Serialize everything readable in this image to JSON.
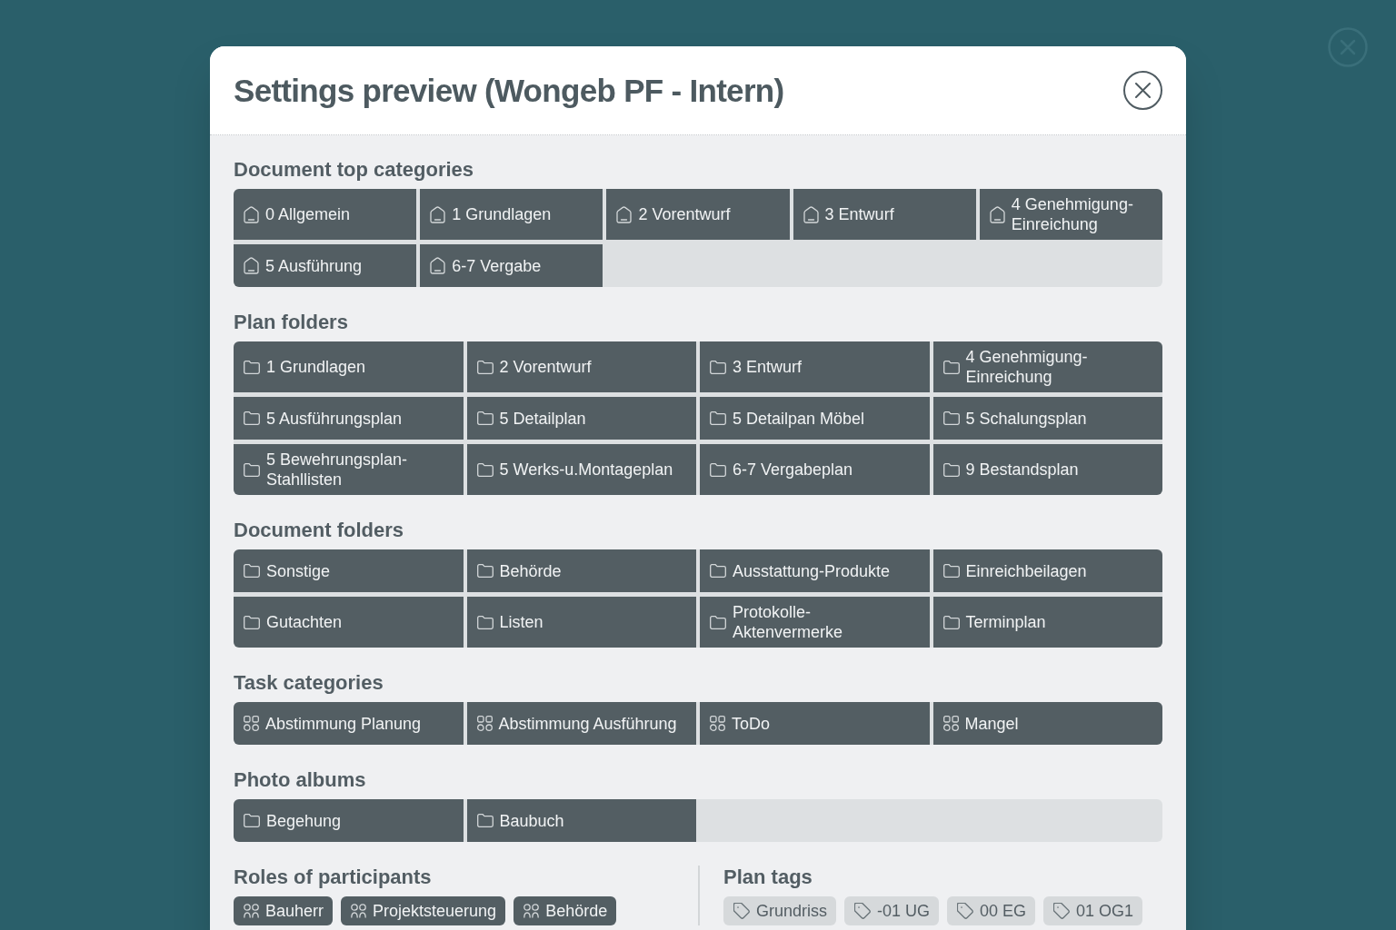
{
  "dialog": {
    "title": "Settings preview (Wongeb PF - Intern)"
  },
  "sections": [
    {
      "heading": "Document top categories",
      "kind": "category",
      "items": [
        "0 Allgemein",
        "1 Grundlagen",
        "2 Vorentwurf",
        "3 Entwurf",
        "4 Genehmigung-Einreichung",
        "5 Ausführung",
        "6-7 Vergabe"
      ]
    },
    {
      "heading": "Plan folders",
      "kind": "folder",
      "items": [
        "1 Grundlagen",
        "2 Vorentwurf",
        "3 Entwurf",
        "4 Genehmigung-Einreichung",
        "5 Ausführungsplan",
        "5 Detailplan",
        "5 Detailpan Möbel",
        "5 Schalungsplan",
        "5 Bewehrungsplan-Stahllisten",
        "5 Werks-u.Montageplan",
        "6-7 Vergabeplan",
        "9 Bestandsplan"
      ]
    },
    {
      "heading": "Document folders",
      "kind": "folder",
      "items": [
        "Sonstige",
        "Behörde",
        "Ausstattung-Produkte",
        "Einreichbeilagen",
        "Gutachten",
        "Listen",
        "Protokolle-Aktenvermerke",
        "Terminplan"
      ]
    },
    {
      "heading": "Task categories",
      "kind": "task",
      "items": [
        "Abstimmung Planung",
        "Abstimmung Ausführung",
        "ToDo",
        "Mangel"
      ]
    },
    {
      "heading": "Photo albums",
      "kind": "folder",
      "items": [
        "Begehung",
        "Baubuch"
      ]
    }
  ],
  "bottom": [
    {
      "heading": "Roles of participants",
      "kind": "role",
      "items": [
        "Bauherr",
        "Projektsteuerung",
        "Behörde"
      ]
    },
    {
      "heading": "Plan tags",
      "kind": "tag",
      "items": [
        "Grundriss",
        "-01 UG",
        "00 EG",
        "01 OG1"
      ]
    }
  ]
}
